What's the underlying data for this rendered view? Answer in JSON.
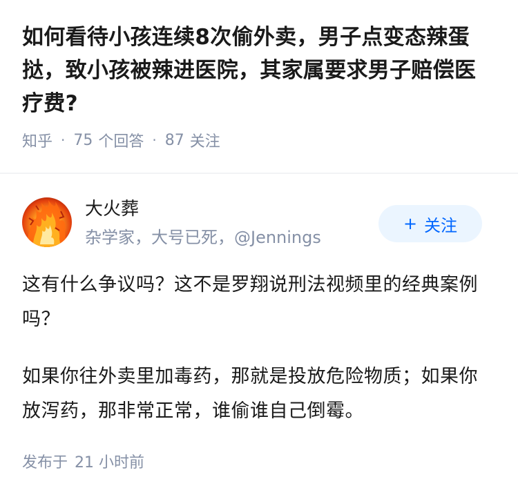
{
  "question": {
    "title": "如何看待小孩连续8次偷外卖，男子点变态辣蛋挞，致小孩被辣进医院，其家属要求男子赔偿医疗费?",
    "platform": "知乎",
    "answers_count": "75",
    "answers_label": "个回答",
    "followers_count": "87",
    "followers_label": "关注"
  },
  "author": {
    "name": "大火葬",
    "bio": "杂学家，大号已死，@Jennings",
    "follow_label": "关注",
    "follow_icon": "plus-icon"
  },
  "answer": {
    "paragraphs": [
      "这有什么争议吗？这不是罗翔说刑法视频里的经典案例吗？",
      "如果你往外卖里加毒药，那就是投放危险物质；如果你放泻药，那非常正常，谁偷谁自己倒霉。"
    ],
    "published_label": "发布于",
    "published_time": "21 小时前"
  },
  "colors": {
    "title": "#1a1a1a",
    "meta": "#8590a6",
    "accent": "#0066ff",
    "follow_bg": "#ebf5ff"
  }
}
